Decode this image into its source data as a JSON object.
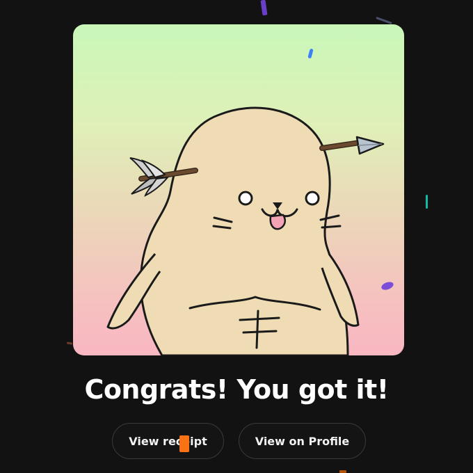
{
  "headline": "Congrats! You got it!",
  "buttons": {
    "view_receipt": "View receipt",
    "view_on_profile": "View on Profile"
  },
  "colors": {
    "background": "#121212",
    "card_gradient_top": "#c9f7b9",
    "card_gradient_bottom": "#f9b7c2",
    "character_fill": "#efdcb4",
    "tongue": "#f3a3b5",
    "confetti": [
      "#6a3fc7",
      "#3b82f6",
      "#14b8a6",
      "#f97316",
      "#7c4dd8"
    ]
  }
}
